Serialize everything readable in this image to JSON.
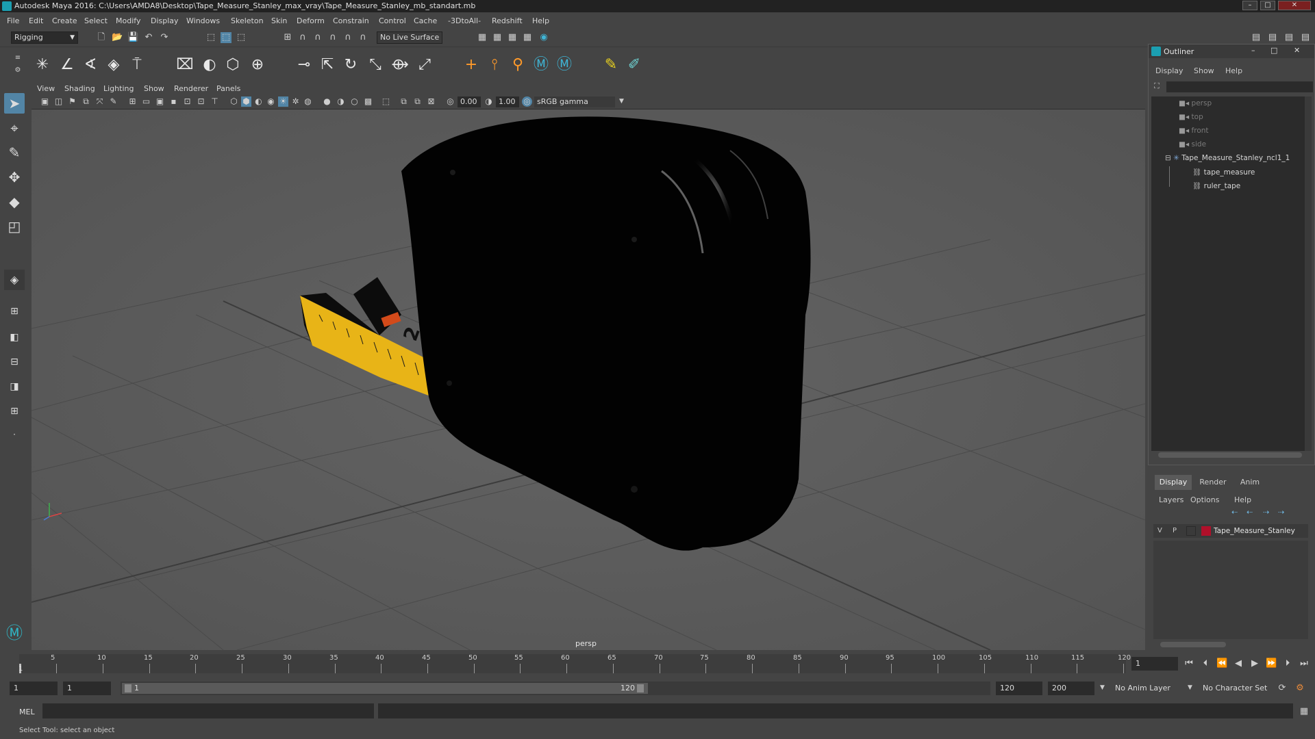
{
  "window": {
    "title": "Autodesk Maya 2016: C:\\Users\\AMDA8\\Desktop\\Tape_Measure_Stanley_max_vray\\Tape_Measure_Stanley_mb_standart.mb",
    "controls": [
      "minimize",
      "maximize",
      "close"
    ]
  },
  "menubar": [
    "File",
    "Edit",
    "Create",
    "Select",
    "Modify",
    "Display",
    "Windows",
    "Skeleton",
    "Skin",
    "Deform",
    "Constrain",
    "Control",
    "Cache",
    "-3DtoAll-",
    "Redshift",
    "Help"
  ],
  "statusline": {
    "menuset": "Rigging",
    "live_surface": "No Live Surface"
  },
  "viewport": {
    "menu": [
      "View",
      "Shading",
      "Lighting",
      "Show",
      "Renderer",
      "Panels"
    ],
    "exposure": "0.00",
    "gamma": "1.00",
    "color_space": "sRGB gamma",
    "camera_label": "persp"
  },
  "outliner": {
    "title": "Outliner",
    "menu": [
      "Display",
      "Show",
      "Help"
    ],
    "items": [
      {
        "label": "persp",
        "type": "camera",
        "dim": true
      },
      {
        "label": "top",
        "type": "camera",
        "dim": true
      },
      {
        "label": "front",
        "type": "camera",
        "dim": true
      },
      {
        "label": "side",
        "type": "camera",
        "dim": true
      },
      {
        "label": "Tape_Measure_Stanley_ncl1_1",
        "type": "group",
        "dim": false
      },
      {
        "label": "tape_measure",
        "type": "mesh",
        "dim": false
      },
      {
        "label": "ruler_tape",
        "type": "mesh",
        "dim": false
      }
    ]
  },
  "layers": {
    "tabs": [
      "Display",
      "Render",
      "Anim"
    ],
    "active_tab": "Display",
    "menu": [
      "Layers",
      "Options",
      "Help"
    ],
    "rows": [
      {
        "v": "V",
        "p": "P",
        "color": "#b0102a",
        "name": "Tape_Measure_Stanley"
      }
    ]
  },
  "timeline": {
    "ticks": [
      "5",
      "10",
      "15",
      "20",
      "25",
      "30",
      "35",
      "40",
      "45",
      "50",
      "55",
      "60",
      "65",
      "70",
      "75",
      "80",
      "85",
      "90",
      "95",
      "100",
      "105",
      "110",
      "115",
      "120"
    ],
    "first_tick": "1",
    "current_frame": "1"
  },
  "range": {
    "start": "1",
    "inner_start": "1",
    "slider_start": "1",
    "slider_end": "120",
    "end": "120",
    "anim_end": "200",
    "anim_layer": "No Anim Layer",
    "character_set": "No Character Set"
  },
  "command": {
    "mode": "MEL",
    "help": "Select Tool: select an object"
  },
  "colors": {
    "background": "#444444",
    "viewport": "#585858",
    "accent": "#5285a6",
    "tape_yellow": "#e8b417",
    "layer_color": "#b0102a"
  }
}
